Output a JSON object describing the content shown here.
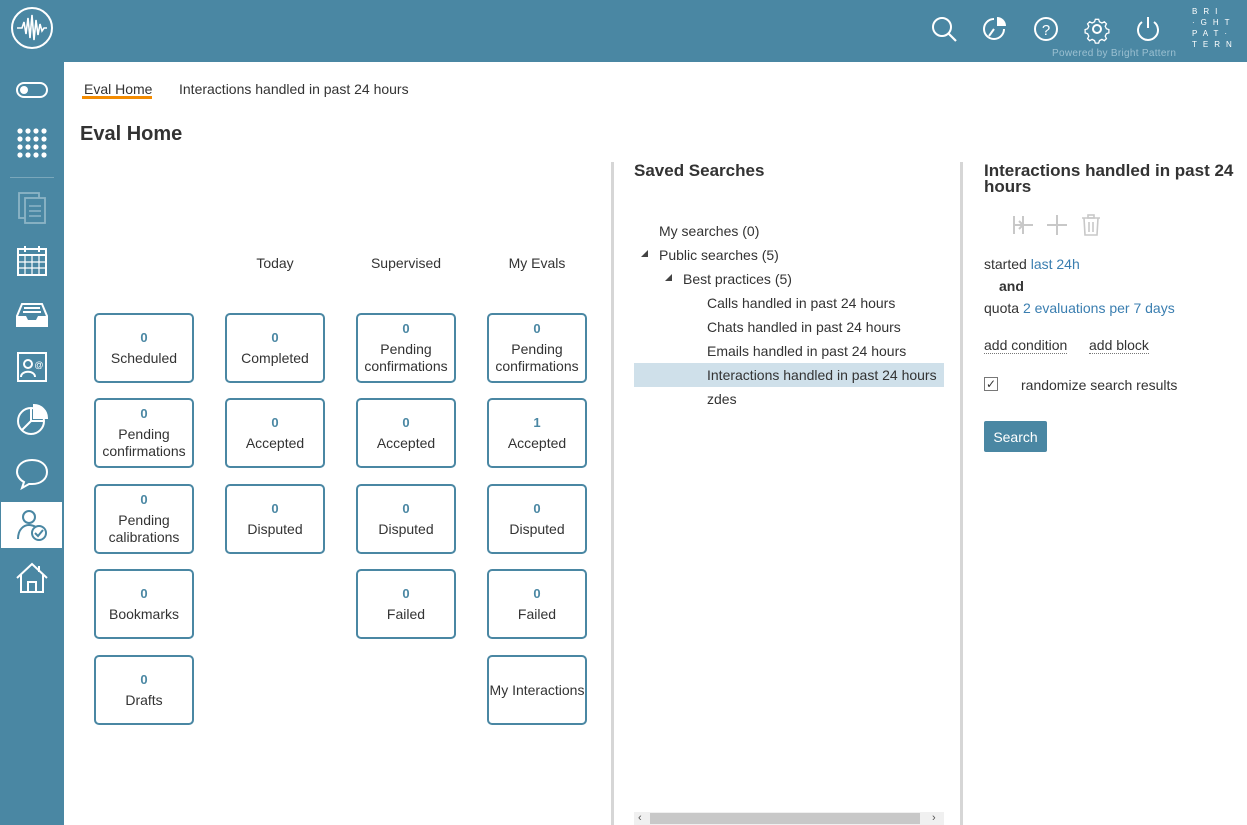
{
  "brand": {
    "logo_icon": "waveform-logo-icon",
    "wordmark_lines": [
      "BRI",
      "·GHT",
      "PAT·",
      "TERN"
    ],
    "powered_by": "Powered by Bright Pattern"
  },
  "topbar_icons": [
    "search-icon",
    "dashboard-icon",
    "help-icon",
    "settings-icon",
    "power-icon"
  ],
  "sidebar_icons": [
    "toggle-icon",
    "dialpad-icon",
    "documents-icon",
    "calendar-icon",
    "inbox-icon",
    "contacts-icon",
    "reports-icon",
    "chat-icon",
    "quality-management-icon",
    "home-icon"
  ],
  "tabs": [
    {
      "label": "Eval Home",
      "active": true
    },
    {
      "label": "Interactions handled in past 24 hours",
      "active": false
    }
  ],
  "page_title": "Eval Home",
  "columns": [
    "Today",
    "Supervised",
    "My Evals"
  ],
  "tiles": {
    "col0": [
      {
        "num": "0",
        "label": "Scheduled"
      },
      {
        "num": "0",
        "label": "Pending confirmations"
      },
      {
        "num": "0",
        "label": "Pending calibrations"
      },
      {
        "num": "0",
        "label": "Bookmarks"
      },
      {
        "num": "0",
        "label": "Drafts"
      }
    ],
    "col1": [
      {
        "num": "0",
        "label": "Completed"
      },
      {
        "num": "0",
        "label": "Accepted"
      },
      {
        "num": "0",
        "label": "Disputed"
      }
    ],
    "col2": [
      {
        "num": "0",
        "label": "Pending confirmations"
      },
      {
        "num": "0",
        "label": "Accepted"
      },
      {
        "num": "0",
        "label": "Disputed"
      },
      {
        "num": "0",
        "label": "Failed"
      }
    ],
    "col3": [
      {
        "num": "0",
        "label": "Pending confirmations"
      },
      {
        "num": "1",
        "label": "Accepted"
      },
      {
        "num": "0",
        "label": "Disputed"
      },
      {
        "num": "0",
        "label": "Failed"
      },
      {
        "num": "",
        "label": "My Interactions"
      }
    ]
  },
  "saved_searches": {
    "title": "Saved Searches",
    "my_searches": "My searches (0)",
    "public_searches": "Public searches (5)",
    "best_practices": "Best practices (5)",
    "items": [
      "Calls handled in past 24 hours",
      "Chats handled in past 24 hours",
      "Emails handled in past 24 hours",
      "Interactions handled in past 24 hours",
      "zdes"
    ],
    "selected_index": 3
  },
  "search_panel": {
    "title": "Interactions handled in past 24 hours",
    "tool_icons": [
      "insert-condition-icon",
      "add-icon",
      "trash-icon"
    ],
    "started_label": "started",
    "started_value": "last 24h",
    "and_label": "and",
    "quota_label": "quota",
    "quota_value": "2 evaluations per 7 days",
    "add_condition": "add condition",
    "add_block": "add block",
    "randomize_label": "randomize search results",
    "randomize_checked": true,
    "search_button": "Search"
  },
  "colors": {
    "accent": "#4a87a3",
    "tab_underline": "#f38b00",
    "link": "#3a7eb0",
    "selection": "#cfe0ea"
  }
}
